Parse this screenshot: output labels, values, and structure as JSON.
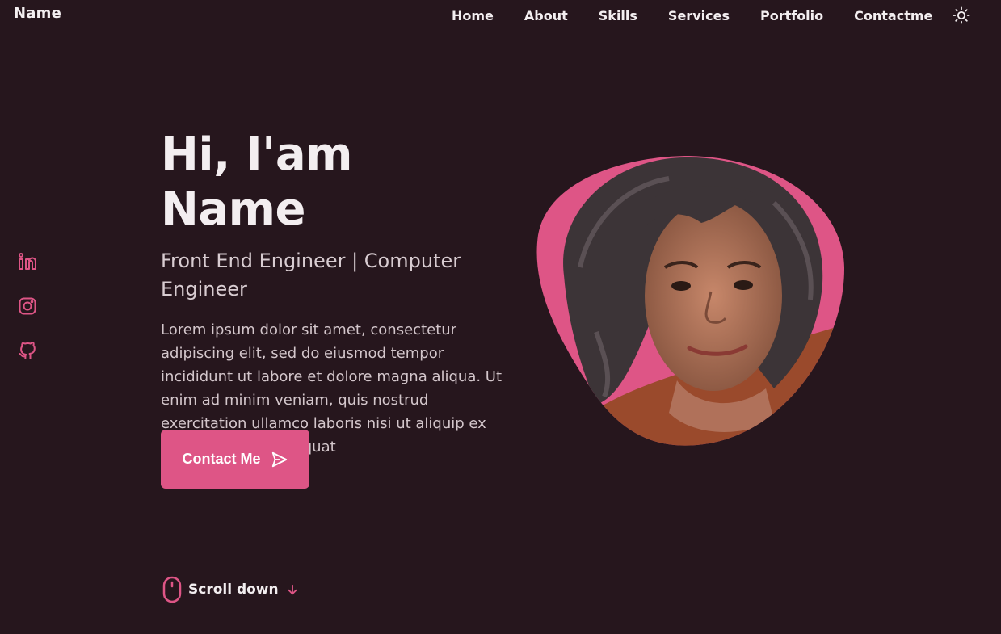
{
  "header": {
    "logo": "Name",
    "nav": [
      "Home",
      "About",
      "Skills",
      "Services",
      "Portfolio",
      "Contactme"
    ],
    "theme_icon": "sun-icon"
  },
  "social": [
    {
      "name": "linkedin-icon"
    },
    {
      "name": "instagram-icon"
    },
    {
      "name": "github-icon"
    }
  ],
  "hero": {
    "title": "Hi, I'am Name",
    "subtitle": "Front End Engineer | Computer Engineer",
    "description": "Lorem ipsum dolor sit amet, consectetur adipiscing elit, sed do eiusmod tempor incididunt ut labore et dolore magna aliqua. Ut enim ad minim veniam, quis nostrud exercitation ullamco laboris nisi ut aliquip ex ea commodo consequat",
    "button_label": "Contact Me",
    "button_icon": "send-icon"
  },
  "scroll": {
    "label": "Scroll down",
    "mouse_icon": "mouse-icon",
    "arrow_icon": "arrow-down-icon"
  },
  "colors": {
    "background": "#26161d",
    "accent": "#de5586",
    "text": "#f3eef0"
  }
}
